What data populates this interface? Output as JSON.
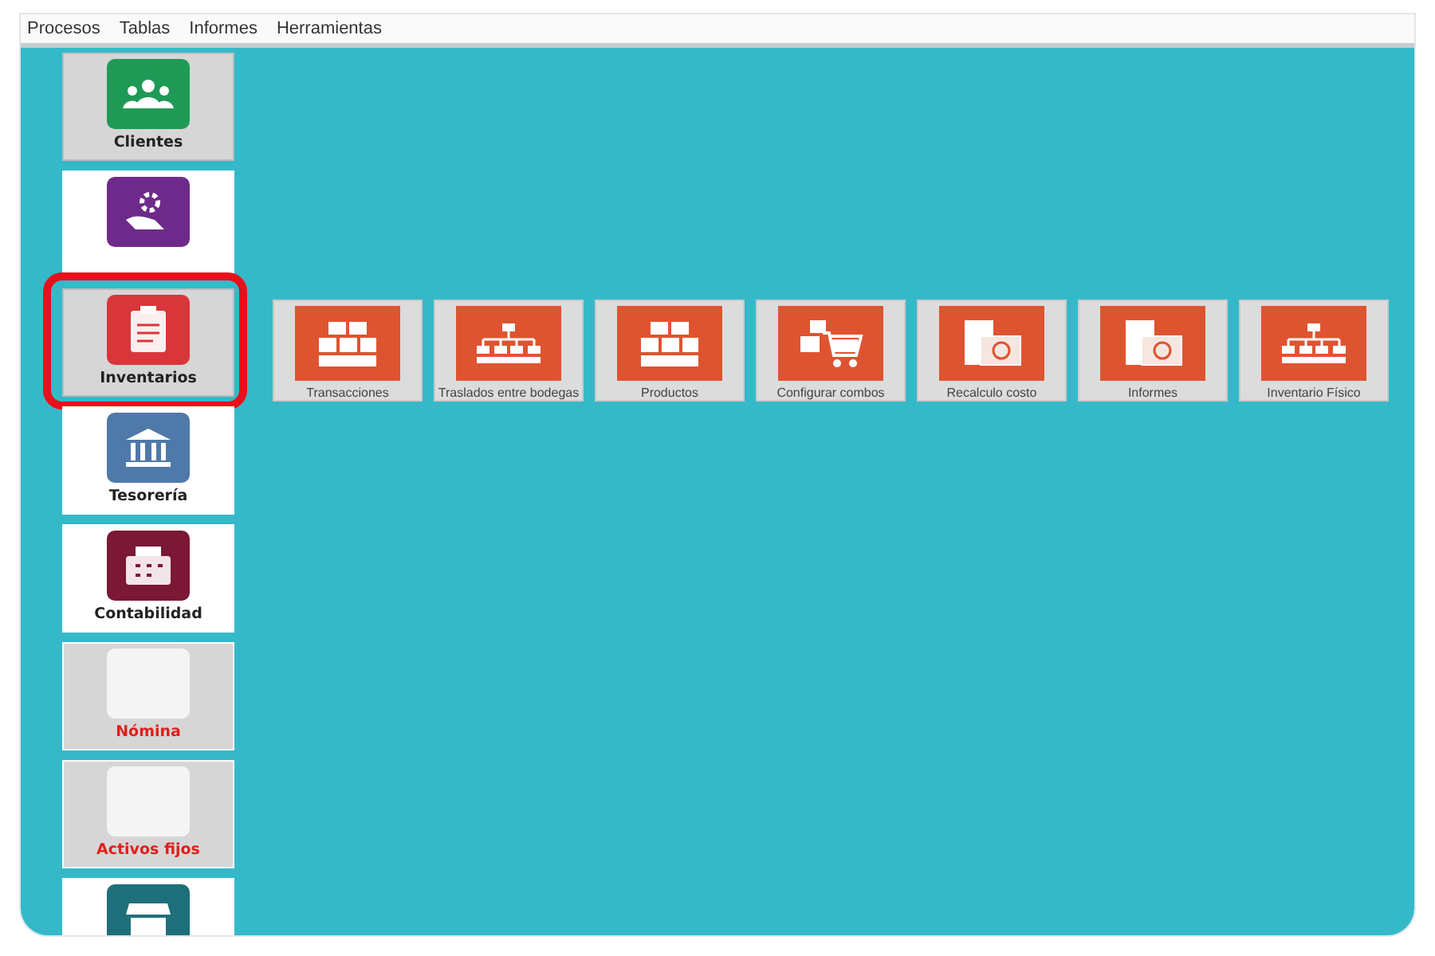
{
  "menu": [
    "Procesos",
    "Tablas",
    "Informes",
    "Herramientas"
  ],
  "sidebar": {
    "items": [
      {
        "label": "Clientes",
        "kind": "people",
        "color": "#1f9a56",
        "selected": true,
        "disabled": false,
        "highlighted": false
      },
      {
        "kind": "gear",
        "color": "#6e2a8a",
        "selected": false,
        "disabled": false,
        "highlighted": false
      },
      {
        "label": "Inventarios",
        "kind": "clipboard",
        "color": "#d8363a",
        "selected": true,
        "disabled": false,
        "highlighted": true
      },
      {
        "label": "Tesorería",
        "kind": "bank",
        "color": "#4f79a8",
        "selected": false,
        "disabled": false,
        "highlighted": false
      },
      {
        "label": "Contabilidad",
        "kind": "register",
        "color": "#7a1836",
        "selected": false,
        "disabled": false,
        "highlighted": false
      },
      {
        "label": "Nómina",
        "kind": "blank",
        "color": "#f4f4f4",
        "selected": false,
        "disabled": true,
        "highlighted": false
      },
      {
        "label": "Activos fijos",
        "kind": "blank",
        "color": "#f4f4f4",
        "selected": false,
        "disabled": true,
        "highlighted": false
      },
      {
        "kind": "store",
        "color": "#1f6f7a",
        "selected": false,
        "disabled": false,
        "highlighted": false
      }
    ]
  },
  "modules": [
    {
      "label": "Transacciones",
      "kind": "boxes"
    },
    {
      "label": "Traslados entre bodegas",
      "kind": "tree"
    },
    {
      "label": "Productos",
      "kind": "boxes"
    },
    {
      "label": "Configurar combos",
      "kind": "cart"
    },
    {
      "label": "Recalculo costo",
      "kind": "docs"
    },
    {
      "label": "Informes",
      "kind": "docs"
    },
    {
      "label": "Inventario Físico",
      "kind": "tree"
    }
  ]
}
